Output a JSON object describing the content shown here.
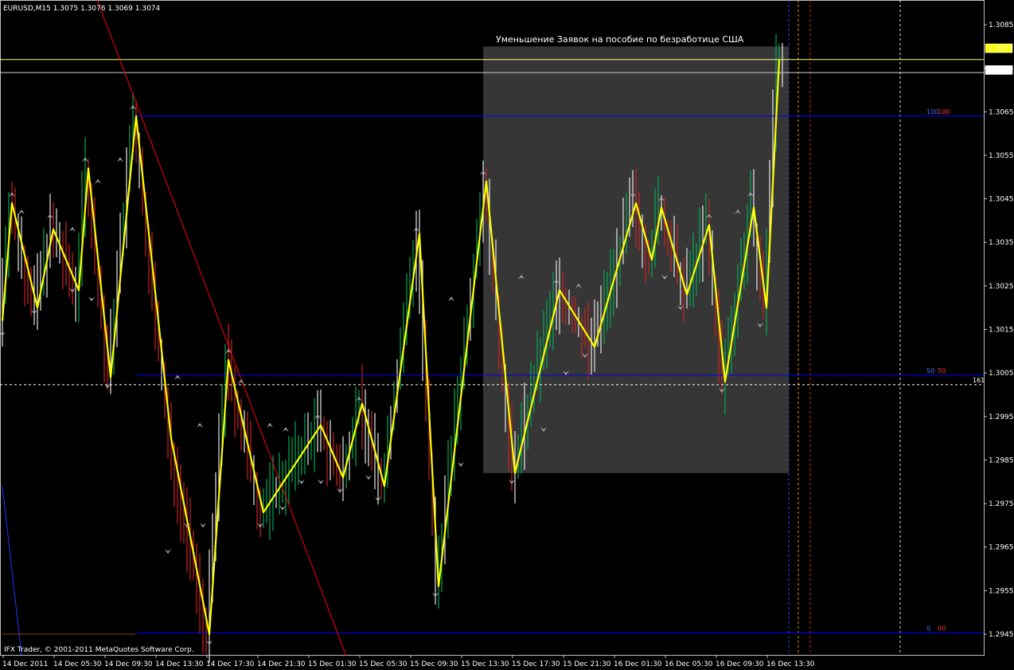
{
  "header": {
    "symbol_info": "EURUSD,M15  1.3075 1.3076 1.3069 1.3074"
  },
  "annotation": "Уменьшение Заявок на пособие по безработице США",
  "copyright": "IFX Trader, © 2001-2011 MetaQuotes Software Corp.",
  "price_tags": {
    "ask": "1.3077",
    "bid": "1.3074",
    "hidden": "1.3077"
  },
  "fib_levels": [
    {
      "name": "100",
      "value": "100",
      "price": 1.3064
    },
    {
      "name": "50",
      "value": "50",
      "price": 1.30045
    },
    {
      "name": "0",
      "value": "00",
      "price": 1.29453
    }
  ],
  "crosshair": {
    "label": "161",
    "price": 1.30023
  },
  "colors": {
    "background": "#000000",
    "grid": "#c0c0c0",
    "zigzag": "#ffff00",
    "fib_line": "#0000ff",
    "trendline": "#ff0000",
    "box": "#404040",
    "bull_candle": "#00aa55",
    "bear_candle": "#cc2222",
    "axis_text": "#ffffff"
  },
  "chart_data": {
    "type": "line",
    "title": "EURUSD,M15",
    "y_axis": {
      "ticks": [
        "1.3085",
        "1.3075",
        "1.3065",
        "1.3055",
        "1.3045",
        "1.3035",
        "1.3025",
        "1.3015",
        "1.3005",
        "1.2995",
        "1.2985",
        "1.2975",
        "1.2965",
        "1.2955",
        "1.2945"
      ],
      "ylim": [
        1.2942,
        1.3089
      ]
    },
    "x_axis": {
      "ticks": [
        "14 Dec 2011",
        "14 Dec 05:30",
        "14 Dec 09:30",
        "14 Dec 13:30",
        "14 Dec 17:30",
        "14 Dec 21:30",
        "15 Dec 01:30",
        "15 Dec 05:30",
        "15 Dec 09:30",
        "15 Dec 13:30",
        "15 Dec 17:30",
        "15 Dec 21:30",
        "16 Dec 01:30",
        "16 Dec 05:30",
        "16 Dec 09:30",
        "16 Dec 13:30"
      ],
      "bars": 245,
      "bars_per_tick": 16
    },
    "grid": "vertical dashed at selected times",
    "zigzag_series": {
      "name": "",
      "points": [
        [
          0,
          1.3017
        ],
        [
          3,
          1.3044
        ],
        [
          11,
          1.302
        ],
        [
          16,
          1.3038
        ],
        [
          24,
          1.3024
        ],
        [
          27,
          1.3052
        ],
        [
          34,
          1.3004
        ],
        [
          42,
          1.3064
        ],
        [
          53,
          1.299
        ],
        [
          65,
          1.2945
        ],
        [
          71,
          1.3008
        ],
        [
          82,
          1.2973
        ],
        [
          100,
          1.2993
        ],
        [
          107,
          1.2981
        ],
        [
          113,
          1.2998
        ],
        [
          120,
          1.2979
        ],
        [
          131,
          1.3037
        ],
        [
          137,
          1.2956
        ],
        [
          152,
          1.3049
        ],
        [
          161,
          1.2982
        ],
        [
          175,
          1.3024
        ],
        [
          186,
          1.3011
        ],
        [
          199,
          1.3044
        ],
        [
          204,
          1.3031
        ],
        [
          207,
          1.3043
        ],
        [
          215,
          1.3023
        ],
        [
          222,
          1.3039
        ],
        [
          227,
          1.3003
        ],
        [
          236,
          1.3043
        ],
        [
          240,
          1.302
        ],
        [
          244,
          1.3077
        ]
      ]
    },
    "fractals_up": [
      [
        3,
        1.3046
      ],
      [
        6,
        1.3042
      ],
      [
        15,
        1.3041
      ],
      [
        22,
        1.3038
      ],
      [
        26,
        1.3054
      ],
      [
        30,
        1.3049
      ],
      [
        37,
        1.3054
      ],
      [
        41,
        1.3066
      ],
      [
        55,
        1.3004
      ],
      [
        62,
        1.2993
      ],
      [
        71,
        1.301
      ],
      [
        75,
        1.3003
      ],
      [
        84,
        1.2993
      ],
      [
        89,
        1.2992
      ],
      [
        99,
        1.2995
      ],
      [
        112,
        1.2999
      ],
      [
        130,
        1.3038
      ],
      [
        141,
        1.3022
      ],
      [
        151,
        1.3051
      ],
      [
        163,
        1.3027
      ],
      [
        174,
        1.3026
      ],
      [
        181,
        1.3025
      ],
      [
        198,
        1.3046
      ],
      [
        207,
        1.3045
      ],
      [
        222,
        1.3041
      ],
      [
        231,
        1.3042
      ],
      [
        235,
        1.3046
      ]
    ],
    "fractals_down": [
      [
        0,
        1.3014
      ],
      [
        10,
        1.3019
      ],
      [
        22,
        1.3024
      ],
      [
        28,
        1.3022
      ],
      [
        33,
        1.3002
      ],
      [
        52,
        1.2964
      ],
      [
        58,
        1.297
      ],
      [
        63,
        1.297
      ],
      [
        65,
        1.2943
      ],
      [
        81,
        1.297
      ],
      [
        88,
        1.2974
      ],
      [
        94,
        1.298
      ],
      [
        100,
        1.298
      ],
      [
        106,
        1.2978
      ],
      [
        115,
        1.2981
      ],
      [
        118,
        1.2976
      ],
      [
        136,
        1.2954
      ],
      [
        144,
        1.2984
      ],
      [
        160,
        1.298
      ],
      [
        170,
        1.2992
      ],
      [
        177,
        1.3005
      ],
      [
        183,
        1.3009
      ],
      [
        208,
        1.3027
      ],
      [
        213,
        1.302
      ],
      [
        226,
        1.3001
      ],
      [
        238,
        1.3016
      ]
    ],
    "trendline": {
      "start": [
        27,
        1.3096
      ],
      "end": [
        108,
        1.294
      ]
    },
    "highlight_box": {
      "from_bar": 151,
      "to_bar": 247,
      "price_top": 1.308,
      "price_bottom": 1.2982
    }
  }
}
